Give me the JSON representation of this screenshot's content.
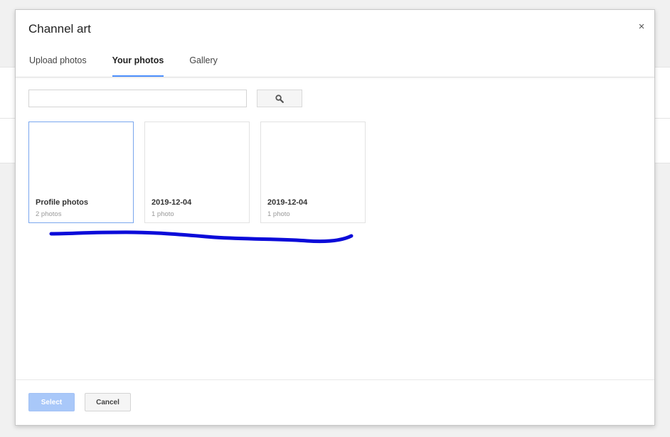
{
  "dialog": {
    "title": "Channel art",
    "close_glyph": "×"
  },
  "tabs": [
    {
      "label": "Upload photos",
      "active": false
    },
    {
      "label": "Your photos",
      "active": true
    },
    {
      "label": "Gallery",
      "active": false
    }
  ],
  "search": {
    "value": "",
    "placeholder": "",
    "button_icon": "search-icon"
  },
  "albums": [
    {
      "name": "Profile photos",
      "count": "2 photos",
      "selected": true
    },
    {
      "name": "2019-12-04",
      "count": "1 photo",
      "selected": false
    },
    {
      "name": "2019-12-04",
      "count": "1 photo",
      "selected": false
    }
  ],
  "footer": {
    "select_label": "Select",
    "cancel_label": "Cancel"
  },
  "colors": {
    "accent": "#4d90fe",
    "annotation": "#0b0bd9",
    "select_disabled": "#a9c8f9"
  }
}
